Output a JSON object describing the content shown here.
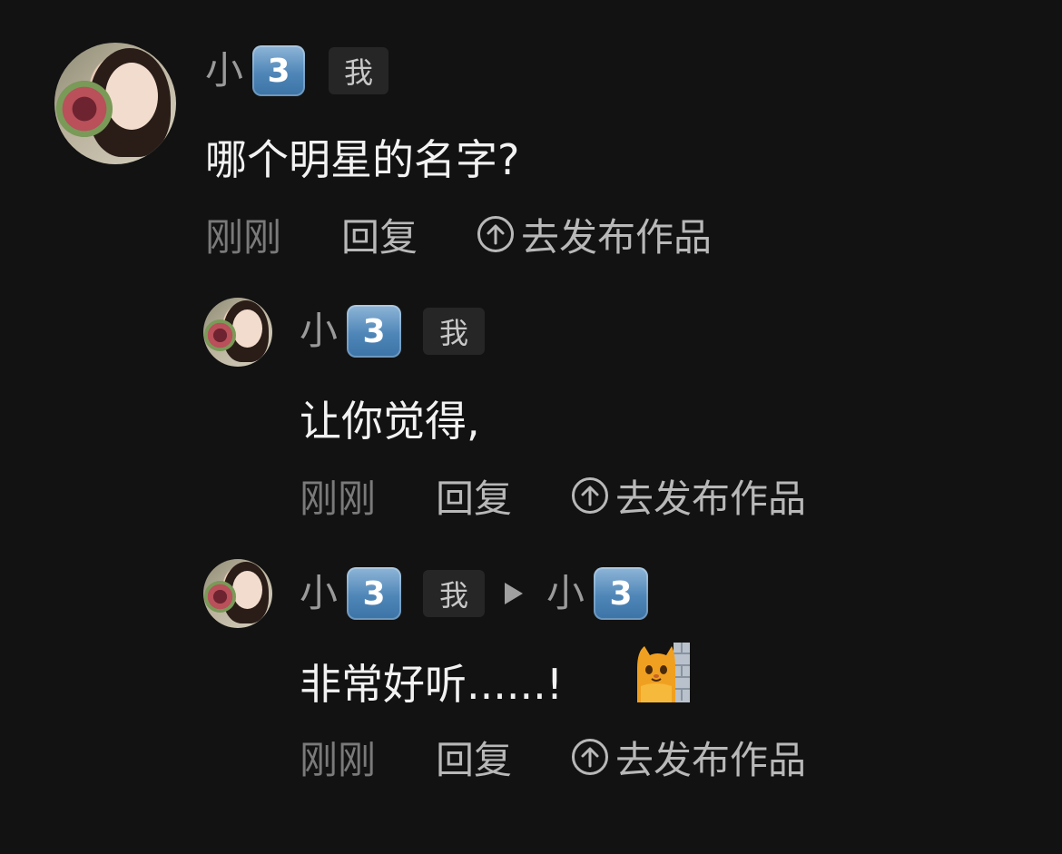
{
  "comments": [
    {
      "username_prefix": "小",
      "username_badge": "3",
      "me_tag": "我",
      "text": "哪个明星的名字?",
      "time": "刚刚",
      "reply_label": "回复",
      "publish_label": "去发布作品"
    },
    {
      "username_prefix": "小",
      "username_badge": "3",
      "me_tag": "我",
      "text": "让你觉得,",
      "time": "刚刚",
      "reply_label": "回复",
      "publish_label": "去发布作品"
    },
    {
      "username_prefix": "小",
      "username_badge": "3",
      "me_tag": "我",
      "reply_to_prefix": "小",
      "reply_to_badge": "3",
      "text": "非常好听......!",
      "emoji": "cat-peeking-wall-emoji",
      "time": "刚刚",
      "reply_label": "回复",
      "publish_label": "去发布作品"
    }
  ],
  "colors": {
    "background": "#121212",
    "username": "#9a9a9a",
    "badge": "#4f86b8",
    "text": "#f2f2f2",
    "meta": "#8c8c8c"
  }
}
